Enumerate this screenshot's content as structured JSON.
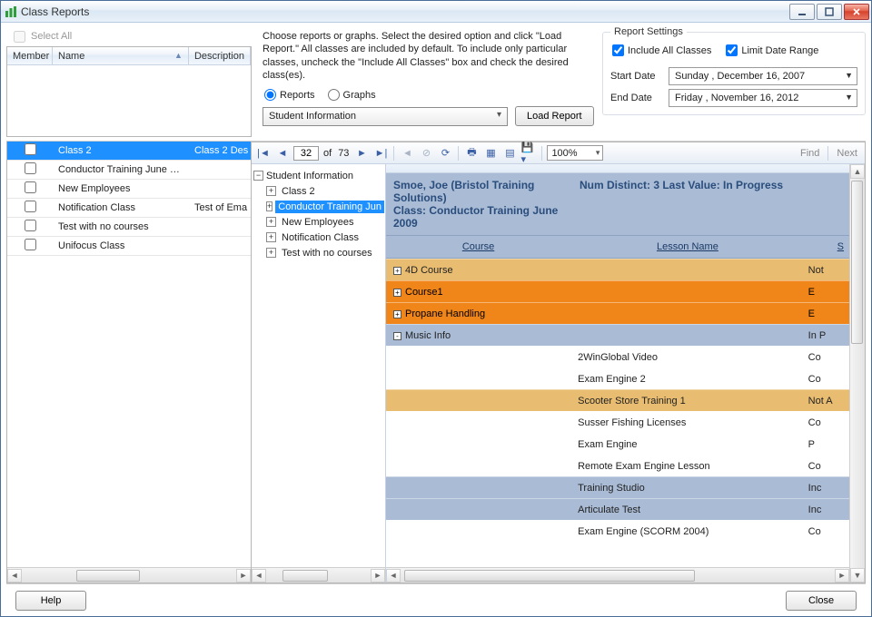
{
  "window": {
    "title": "Class Reports"
  },
  "left": {
    "select_all_label": "Select All",
    "headers": {
      "member": "Member",
      "name": "Name",
      "desc": "Description"
    },
    "rows": [
      {
        "name": "Class 2",
        "desc": "Class 2 Des",
        "selected": true
      },
      {
        "name": "Conductor Training June 2009",
        "desc": ""
      },
      {
        "name": "New Employees",
        "desc": ""
      },
      {
        "name": "Notification Class",
        "desc": "Test of Ema"
      },
      {
        "name": "Test with no courses",
        "desc": ""
      },
      {
        "name": "Unifocus Class",
        "desc": ""
      }
    ]
  },
  "mid": {
    "instruction": "Choose reports or graphs. Select the desired option and click \"Load Report.\" All classes are included by default. To include only particular classes, uncheck the \"Include All Classes\" box and check the desired class(es).",
    "reports_label": "Reports",
    "graphs_label": "Graphs",
    "combo_value": "Student Information",
    "load_label": "Load Report"
  },
  "settings": {
    "legend": "Report Settings",
    "include_all": "Include All Classes",
    "limit_range": "Limit Date Range",
    "start_label": "Start Date",
    "end_label": "End Date",
    "start_value": "Sunday   , December 16, 2007",
    "end_value": "Friday     , November 16, 2012"
  },
  "toolbar": {
    "page": "32",
    "of": "of",
    "total": "73",
    "zoom": "100%",
    "find": "Find",
    "next": "Next"
  },
  "tree": {
    "root": "Student Information",
    "items": [
      {
        "label": "Class 2"
      },
      {
        "label": "Conductor Training Jun",
        "selected": true
      },
      {
        "label": "New Employees"
      },
      {
        "label": "Notification Class"
      },
      {
        "label": "Test with no courses"
      }
    ]
  },
  "report": {
    "group": {
      "left": "Smoe, Joe (Bristol Training Solutions)\nClass: Conductor Training June 2009",
      "right": "Num Distinct: 3 Last Value: In Progress"
    },
    "cols": {
      "a": "Course",
      "b": "Lesson Name",
      "c": "S"
    },
    "rows": [
      {
        "bg": "gold",
        "toggle": "+",
        "a": "4D Course",
        "b": "",
        "c": "Not"
      },
      {
        "bg": "orange",
        "toggle": "+",
        "a": "Course1",
        "b": "",
        "c": "E"
      },
      {
        "bg": "orange",
        "toggle": "+",
        "a": "Propane Handling",
        "b": "",
        "c": "E"
      },
      {
        "bg": "blue",
        "toggle": "-",
        "a": "Music Info",
        "b": "",
        "c": "In P"
      },
      {
        "bg": "white",
        "a": "",
        "b": "2WinGlobal Video",
        "c": "Co"
      },
      {
        "bg": "white",
        "a": "",
        "b": "Exam Engine 2",
        "c": "Co"
      },
      {
        "bg": "gold",
        "a": "",
        "b": "Scooter Store Training 1",
        "c": "Not A"
      },
      {
        "bg": "white",
        "a": "",
        "b": "Susser Fishing Licenses",
        "c": "Co"
      },
      {
        "bg": "white",
        "a": "",
        "b": "Exam Engine",
        "c": "P"
      },
      {
        "bg": "white",
        "a": "",
        "b": "Remote Exam Engine Lesson",
        "c": "Co"
      },
      {
        "bg": "blue",
        "a": "",
        "b": "Training Studio",
        "c": "Inc"
      },
      {
        "bg": "blue",
        "a": "",
        "b": "Articulate Test",
        "c": "Inc"
      },
      {
        "bg": "white",
        "a": "",
        "b": "Exam Engine (SCORM 2004)",
        "c": "Co"
      }
    ]
  },
  "footer": {
    "help": "Help",
    "close": "Close"
  }
}
